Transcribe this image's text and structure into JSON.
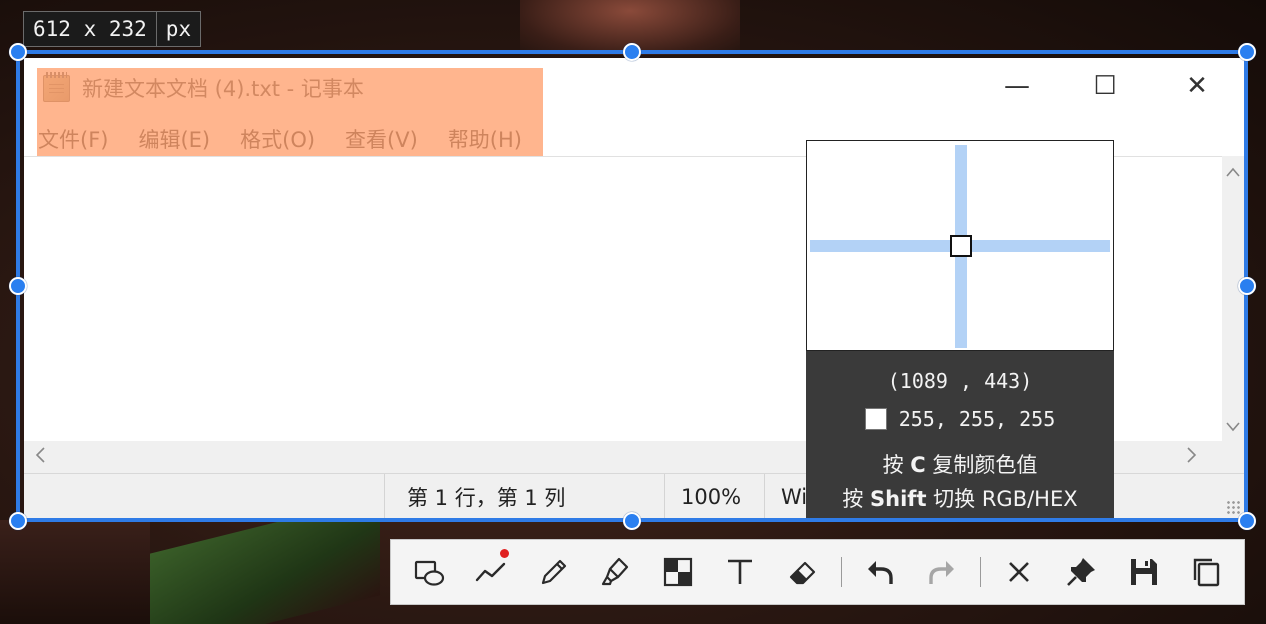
{
  "selection": {
    "size_text": "612 x 232",
    "unit": "px"
  },
  "notepad": {
    "title": "新建文本文档 (4).txt - 记事本",
    "window_buttons": {
      "minimize": "—",
      "maximize": "☐",
      "close": "✕"
    },
    "menu": [
      "文件(F)",
      "编辑(E)",
      "格式(O)",
      "查看(V)",
      "帮助(H)"
    ],
    "status": {
      "position": "第 1 行，第 1 列",
      "zoom": "100%",
      "encoding": "Windows (CRLF)"
    }
  },
  "magnifier": {
    "coords": "(1089 , 443)",
    "rgb": "255, 255, 255",
    "swatch_color": "#ffffff",
    "hint_copy_prefix": "按 ",
    "hint_copy_key": "C",
    "hint_copy_suffix": " 复制颜色值",
    "hint_toggle_prefix": "按 ",
    "hint_toggle_key": "Shift",
    "hint_toggle_suffix": " 切换 RGB/HEX"
  },
  "toolbar": {
    "tools": [
      {
        "name": "rectangle-ellipse-tool",
        "icon": "shapes-icon"
      },
      {
        "name": "line-tool",
        "icon": "polyline-icon",
        "badge": true
      },
      {
        "name": "pen-tool",
        "icon": "pencil-icon"
      },
      {
        "name": "marker-tool",
        "icon": "highlighter-icon"
      },
      {
        "name": "mosaic-tool",
        "icon": "mosaic-icon"
      },
      {
        "name": "text-tool",
        "icon": "text-icon"
      },
      {
        "name": "eraser-tool",
        "icon": "eraser-icon"
      },
      {
        "name": "undo-button",
        "icon": "undo-icon"
      },
      {
        "name": "redo-button",
        "icon": "redo-icon",
        "disabled": true
      },
      {
        "name": "cancel-button",
        "icon": "close-icon"
      },
      {
        "name": "pin-button",
        "icon": "pin-icon"
      },
      {
        "name": "save-button",
        "icon": "save-icon"
      },
      {
        "name": "copy-button",
        "icon": "copy-icon"
      }
    ]
  },
  "colors": {
    "selection_accent": "#2f7be6",
    "highlight": "#ffa06e",
    "crosshair": "#b3d2f6"
  }
}
